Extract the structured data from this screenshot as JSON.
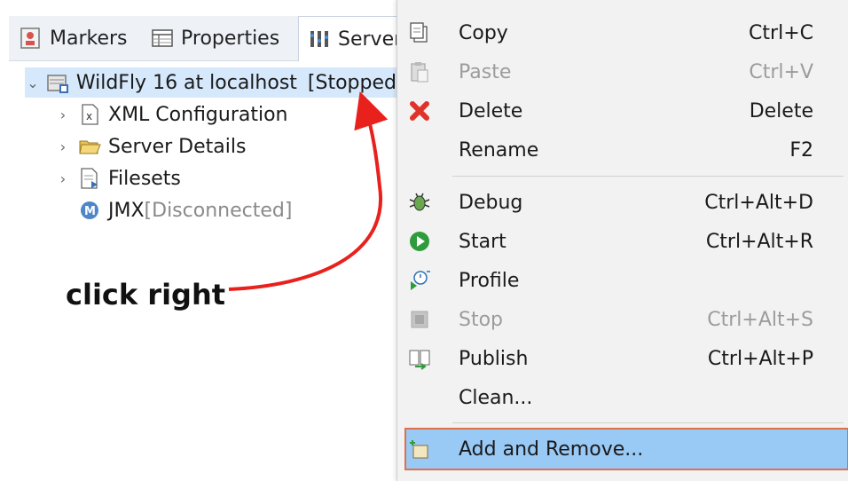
{
  "tabs": [
    {
      "label": "Markers"
    },
    {
      "label": "Properties"
    },
    {
      "label": "Servers"
    }
  ],
  "tree": {
    "server": {
      "name": "WildFly 16 at localhost",
      "state": "[Stopped"
    },
    "children": [
      {
        "label": "XML Configuration"
      },
      {
        "label": "Server Details"
      },
      {
        "label": "Filesets"
      }
    ],
    "jmx": {
      "label": "JMX",
      "status": "[Disconnected]"
    }
  },
  "annotation": {
    "text": "click right",
    "arrow_color": "#e8211c"
  },
  "context_menu": {
    "items": [
      {
        "label": "Copy",
        "shortcut": "Ctrl+C",
        "enabled": true
      },
      {
        "label": "Paste",
        "shortcut": "Ctrl+V",
        "enabled": false
      },
      {
        "label": "Delete",
        "shortcut": "Delete",
        "enabled": true
      },
      {
        "label": "Rename",
        "shortcut": "F2",
        "enabled": true
      },
      {
        "label": "Debug",
        "shortcut": "Ctrl+Alt+D",
        "enabled": true
      },
      {
        "label": "Start",
        "shortcut": "Ctrl+Alt+R",
        "enabled": true
      },
      {
        "label": "Profile",
        "shortcut": "",
        "enabled": true
      },
      {
        "label": "Stop",
        "shortcut": "Ctrl+Alt+S",
        "enabled": false
      },
      {
        "label": "Publish",
        "shortcut": "Ctrl+Alt+P",
        "enabled": true
      },
      {
        "label": "Clean...",
        "shortcut": "",
        "enabled": true
      },
      {
        "label": "Add and Remove...",
        "shortcut": "",
        "enabled": true,
        "highlighted": true
      }
    ]
  },
  "colors": {
    "highlight": "#99c9f5",
    "highlight_border": "#e0704a",
    "selection": "#d6e8fb",
    "menu_bg": "#f2f2f2"
  }
}
